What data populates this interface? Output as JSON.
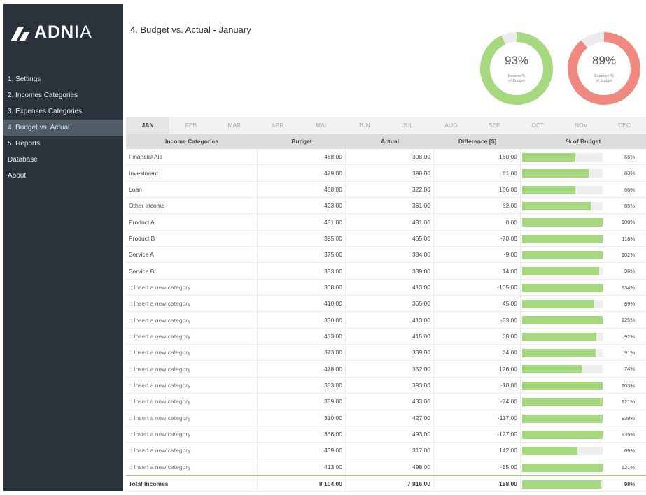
{
  "brand": {
    "logo_text_bold": "ADN",
    "logo_text_thin": "IA"
  },
  "sidebar": {
    "items": [
      {
        "label": "1. Settings",
        "active": false
      },
      {
        "label": "2. Incomes Categories",
        "active": false
      },
      {
        "label": "3. Expenses Categories",
        "active": false
      },
      {
        "label": "4. Budget vs. Actual",
        "active": true
      },
      {
        "label": "5. Reports",
        "active": false
      },
      {
        "label": "Database",
        "active": false
      },
      {
        "label": "About",
        "active": false
      }
    ]
  },
  "header": {
    "title": "4. Budget vs. Actual - January"
  },
  "gauges": {
    "income": {
      "value": "93%",
      "fraction": 0.93,
      "label_line1": "Income %",
      "label_line2": "of Budget",
      "color": "#a6d87f"
    },
    "expense": {
      "value": "89%",
      "fraction": 0.89,
      "label_line1": "Expense %",
      "label_line2": "of Budget",
      "color": "#f08a80"
    }
  },
  "months": {
    "active": 0,
    "labels": [
      "JAN",
      "FEB",
      "MAR",
      "APR",
      "MAI",
      "JUN",
      "JUL",
      "AUG",
      "SEP",
      "OCT",
      "NOV",
      "DEC"
    ]
  },
  "table": {
    "headers": {
      "category": "Income Categories",
      "budget": "Budget",
      "actual": "Actual",
      "difference": "Difference [$]",
      "percent": "% of Budget"
    },
    "rows": [
      {
        "name": "Financial Aid",
        "budget": "468,00",
        "actual": "308,00",
        "difference": "160,00",
        "percent": "66%",
        "fill": 0.66,
        "placeholder": false
      },
      {
        "name": "Investment",
        "budget": "479,00",
        "actual": "398,00",
        "difference": "81,00",
        "percent": "83%",
        "fill": 0.83,
        "placeholder": false
      },
      {
        "name": "Loan",
        "budget": "488,00",
        "actual": "322,00",
        "difference": "166,00",
        "percent": "66%",
        "fill": 0.66,
        "placeholder": false
      },
      {
        "name": "Other Income",
        "budget": "423,00",
        "actual": "361,00",
        "difference": "62,00",
        "percent": "85%",
        "fill": 0.85,
        "placeholder": false
      },
      {
        "name": "Product A",
        "budget": "481,00",
        "actual": "481,00",
        "difference": "0,00",
        "percent": "100%",
        "fill": 1.0,
        "placeholder": false
      },
      {
        "name": "Product B",
        "budget": "395,00",
        "actual": "465,00",
        "difference": "-70,00",
        "percent": "118%",
        "fill": 1.0,
        "placeholder": false
      },
      {
        "name": "Service A",
        "budget": "375,00",
        "actual": "384,00",
        "difference": "-9,00",
        "percent": "102%",
        "fill": 1.0,
        "placeholder": false
      },
      {
        "name": "Service B",
        "budget": "353,00",
        "actual": "339,00",
        "difference": "14,00",
        "percent": "96%",
        "fill": 0.96,
        "placeholder": false
      },
      {
        "name": ":: Insert a new category",
        "budget": "308,00",
        "actual": "413,00",
        "difference": "-105,00",
        "percent": "134%",
        "fill": 1.0,
        "placeholder": true
      },
      {
        "name": ":: Insert a new category",
        "budget": "410,00",
        "actual": "365,00",
        "difference": "45,00",
        "percent": "89%",
        "fill": 0.89,
        "placeholder": true
      },
      {
        "name": ":: Insert a new category",
        "budget": "330,00",
        "actual": "413,00",
        "difference": "-83,00",
        "percent": "125%",
        "fill": 1.0,
        "placeholder": true
      },
      {
        "name": ":: Insert a new category",
        "budget": "453,00",
        "actual": "415,00",
        "difference": "38,00",
        "percent": "92%",
        "fill": 0.92,
        "placeholder": true
      },
      {
        "name": ":: Insert a new category",
        "budget": "373,00",
        "actual": "339,00",
        "difference": "34,00",
        "percent": "91%",
        "fill": 0.91,
        "placeholder": true
      },
      {
        "name": ":: Insert a new category",
        "budget": "478,00",
        "actual": "352,00",
        "difference": "126,00",
        "percent": "74%",
        "fill": 0.74,
        "placeholder": true
      },
      {
        "name": ":: Insert a new category",
        "budget": "383,00",
        "actual": "393,00",
        "difference": "-10,00",
        "percent": "103%",
        "fill": 1.0,
        "placeholder": true
      },
      {
        "name": ":: Insert a new category",
        "budget": "359,00",
        "actual": "433,00",
        "difference": "-74,00",
        "percent": "121%",
        "fill": 1.0,
        "placeholder": true
      },
      {
        "name": ":: Insert a new category",
        "budget": "310,00",
        "actual": "427,00",
        "difference": "-117,00",
        "percent": "138%",
        "fill": 1.0,
        "placeholder": true
      },
      {
        "name": ":: Insert a new category",
        "budget": "366,00",
        "actual": "493,00",
        "difference": "-127,00",
        "percent": "135%",
        "fill": 1.0,
        "placeholder": true
      },
      {
        "name": ":: Insert a new category",
        "budget": "459,00",
        "actual": "317,00",
        "difference": "142,00",
        "percent": "69%",
        "fill": 0.69,
        "placeholder": true
      },
      {
        "name": ":: Insert a new category",
        "budget": "413,00",
        "actual": "498,00",
        "difference": "-85,00",
        "percent": "121%",
        "fill": 1.0,
        "placeholder": true
      }
    ],
    "total": {
      "name": "Total Incomes",
      "budget": "8 104,00",
      "actual": "7 916,00",
      "difference": "188,00",
      "percent": "98%",
      "fill": 0.98
    }
  },
  "colors": {
    "sidebar_bg": "#2a333b",
    "sidebar_active": "#4f5d69",
    "bar_fill": "#a6d87f",
    "bar_track": "#eeeeee"
  }
}
